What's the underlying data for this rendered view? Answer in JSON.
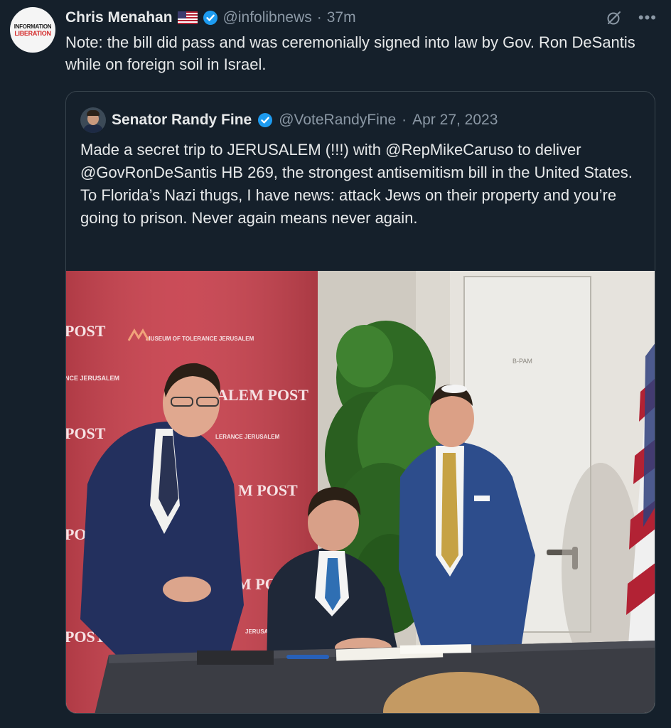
{
  "tweet": {
    "avatar_line1": "INFORMATION",
    "avatar_line2": "LIBERATION",
    "author_name": "Chris Menahan",
    "flag_icon": "us-flag-icon",
    "handle": "@infolibnews",
    "separator": "·",
    "time": "37m",
    "text": "Note: the bill did pass and was ceremonially signed into law by Gov. Ron DeSantis while on foreign soil in Israel."
  },
  "quoted": {
    "author_name": "Senator Randy Fine",
    "handle": "@VoteRandyFine",
    "separator": "·",
    "date": "Apr 27, 2023",
    "text": "Made a secret trip to JERUSALEM (!!!) with @RepMikeCaruso to deliver @GovRonDeSantis HB 269, the strongest antisemitism bill in the United States.   To Florida’s Nazi thugs, I have news: attack Jews on their property and you’re going to prison.   Never again means never again."
  },
  "photo": {
    "backdrop_texts": [
      "POST",
      "MUSEUM OF TOLERANCE JERUSALEM",
      "NCE JERUSALEM",
      "ALEM POST",
      "POST",
      "LERANCE JERUSALEM",
      "M POST",
      "POST",
      "JERUSALEM",
      "M PO",
      "POST"
    ],
    "door_sign": "B-PAM"
  },
  "colors": {
    "background": "#15202b",
    "text": "#e7e9ea",
    "muted": "#8b98a5",
    "verified": "#1d9bf0",
    "border": "#38444d",
    "backdrop_red": "#c8434f"
  }
}
